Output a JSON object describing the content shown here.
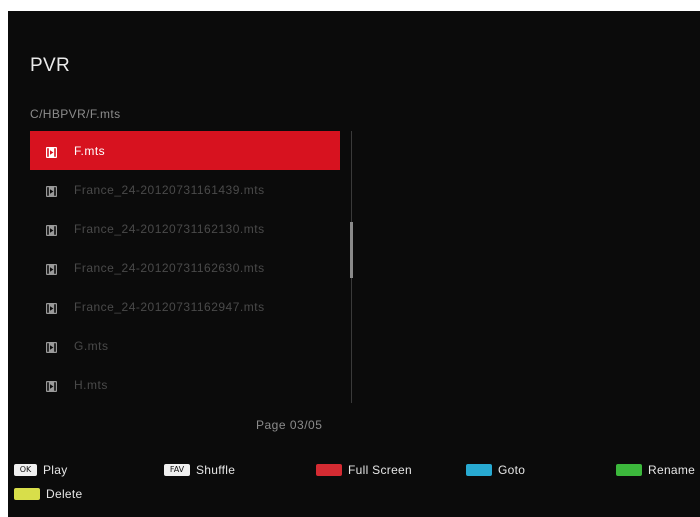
{
  "header": {
    "title": "PVR",
    "path": "C/HBPVR/F.mts"
  },
  "file_list": {
    "selected_index": 0,
    "icon": "video-file-icon",
    "items": [
      {
        "name": "F.mts"
      },
      {
        "name": "France_24-20120731161439.mts"
      },
      {
        "name": "France_24-20120731162130.mts"
      },
      {
        "name": "France_24-20120731162630.mts"
      },
      {
        "name": "France_24-20120731162947.mts"
      },
      {
        "name": "G.mts"
      },
      {
        "name": "H.mts"
      }
    ]
  },
  "pager": {
    "label": "Page 03/05"
  },
  "colors": {
    "selection": "#d7121f",
    "background": "#0b0b0b",
    "red_key": "#d42b32",
    "blue_key": "#28aad2",
    "green_key": "#3cb83c",
    "yellow_key": "#d8de4a"
  },
  "legend": {
    "ok": {
      "key": "OK",
      "label": "Play"
    },
    "fav": {
      "key": "FAV",
      "label": "Shuffle"
    },
    "red": {
      "label": "Full Screen"
    },
    "blue": {
      "label": "Goto"
    },
    "green": {
      "label": "Rename"
    },
    "yellow": {
      "label": "Delete"
    }
  }
}
